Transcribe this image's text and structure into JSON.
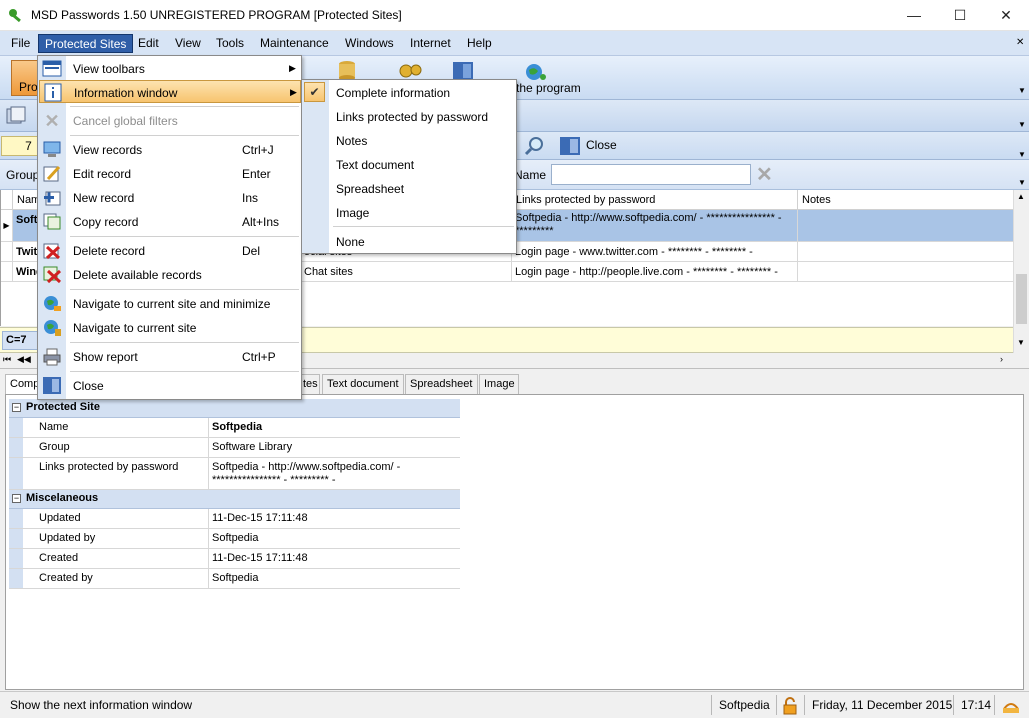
{
  "window": {
    "title": "MSD Passwords 1.50 UNREGISTERED PROGRAM [Protected Sites]",
    "minimize": "—",
    "maximize": "☐",
    "close": "✕"
  },
  "menubar": [
    "File",
    "Protected Sites",
    "Edit",
    "View",
    "Tools",
    "Maintenance",
    "Windows",
    "Internet",
    "Help"
  ],
  "toolbar": {
    "pressed_label": "Pro",
    "about_label": "the program"
  },
  "toolbar3": {
    "counter": "7",
    "close_label": "Close"
  },
  "filter": {
    "group_label": "Group",
    "name_label": "Name",
    "name_value": ""
  },
  "grid": {
    "columns": [
      "Nam",
      "Links protected by password",
      "Notes"
    ],
    "rows": [
      {
        "name": "Soft",
        "group": "",
        "links": "Softpedia - http://www.softpedia.com/ - **************** - *********",
        "notes": ""
      },
      {
        "name": "Twit",
        "group": "ocial sites",
        "links": "Login page - www.twitter.com - ******** - ******** -",
        "notes": ""
      },
      {
        "name": "Wind",
        "group": "Chat sites",
        "links": "Login page - http://people.live.com - ******** - ******** -",
        "notes": ""
      }
    ],
    "summary": "C=7"
  },
  "tabs": [
    "Comp",
    "tes",
    "Text document",
    "Spreadsheet",
    "Image"
  ],
  "info": {
    "sections": [
      {
        "title": "Protected Site",
        "rows": [
          {
            "key": "Name",
            "value": "Softpedia"
          },
          {
            "key": "Group",
            "value": "Software Library"
          },
          {
            "key": "Links protected by password",
            "value": "Softpedia - http://www.softpedia.com/ - **************** - ********* -"
          }
        ]
      },
      {
        "title": "Miscelaneous",
        "rows": [
          {
            "key": "Updated",
            "value": "11-Dec-15 17:11:48"
          },
          {
            "key": "Updated by",
            "value": "Softpedia"
          },
          {
            "key": "Created",
            "value": "11-Dec-15 17:11:48"
          },
          {
            "key": "Created by",
            "value": "Softpedia"
          }
        ]
      }
    ]
  },
  "menu": {
    "items": [
      {
        "label": "View toolbars",
        "shortcut": "",
        "icon": "toolbars-icon"
      },
      {
        "label": "Information window",
        "shortcut": "",
        "icon": "info-icon"
      },
      {
        "label": "Cancel global filters",
        "shortcut": "",
        "icon": "cancel-filter-icon"
      },
      {
        "label": "View records",
        "shortcut": "Ctrl+J",
        "icon": "view-records-icon"
      },
      {
        "label": "Edit record",
        "shortcut": "Enter",
        "icon": "edit-record-icon"
      },
      {
        "label": "New record",
        "shortcut": "Ins",
        "icon": "new-record-icon"
      },
      {
        "label": "Copy record",
        "shortcut": "Alt+Ins",
        "icon": "copy-record-icon"
      },
      {
        "label": "Delete record",
        "shortcut": "Del",
        "icon": "delete-record-icon"
      },
      {
        "label": "Delete available records",
        "shortcut": "",
        "icon": "delete-records-icon"
      },
      {
        "label": "Navigate to current site and minimize",
        "shortcut": "",
        "icon": "navigate-minimize-icon"
      },
      {
        "label": "Navigate to current site",
        "shortcut": "",
        "icon": "navigate-icon"
      },
      {
        "label": "Show report",
        "shortcut": "Ctrl+P",
        "icon": "printer-icon"
      },
      {
        "label": "Close",
        "shortcut": "",
        "icon": "close-door-icon"
      }
    ]
  },
  "submenu": {
    "items": [
      "Complete information",
      "Links protected by password",
      "Notes",
      "Text document",
      "Spreadsheet",
      "Image",
      "None"
    ],
    "checked": "Complete information"
  },
  "status": {
    "message": "Show the next information window",
    "user": "Softpedia",
    "date": "Friday, 11 December 2015",
    "time": "17:14"
  },
  "colors": {
    "menubar_bg": "#d7e4f5",
    "highlight": "#f7c46f",
    "selection": "#a9c4e6"
  }
}
